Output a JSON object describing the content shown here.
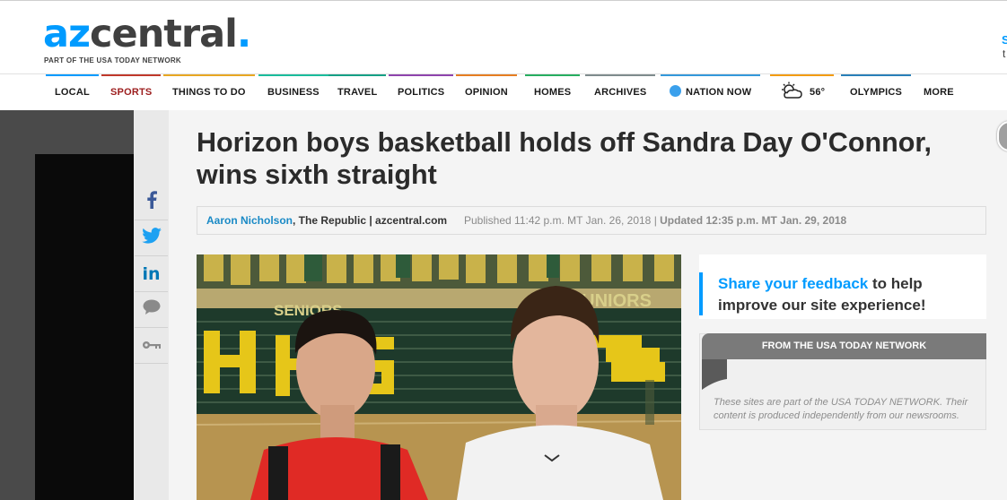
{
  "brand": {
    "logo_az": "az",
    "logo_central": "central",
    "logo_dot": ".",
    "tagline": "PART OF THE USA TODAY NETWORK",
    "edge_text_1": "S",
    "edge_text_2": "t"
  },
  "colors": {
    "brand_blue": "#009bff",
    "active_nav": "#9c1d1d",
    "headline": "#2b2b2b"
  },
  "nav": {
    "items": [
      {
        "label": "LOCAL",
        "color": "#009bff"
      },
      {
        "label": "SPORTS",
        "color": "#c0392b"
      },
      {
        "label": "THINGS TO DO",
        "color": "#e8a723"
      },
      {
        "label": "BUSINESS",
        "color": "#1abc9c"
      },
      {
        "label": "TRAVEL",
        "color": "#16a085"
      },
      {
        "label": "POLITICS",
        "color": "#8e44ad"
      },
      {
        "label": "OPINION",
        "color": "#e67e22"
      },
      {
        "label": "HOMES",
        "color": "#27ae60"
      },
      {
        "label": "ARCHIVES",
        "color": "#7f8c8d"
      },
      {
        "label": "NATION NOW",
        "color": "#3498db"
      },
      {
        "label": "56°",
        "color": "#f39c12"
      },
      {
        "label": "OLYMPICS",
        "color": "#2980b9"
      },
      {
        "label": "MORE",
        "color": "#ffffff"
      }
    ],
    "weather_icon": "partly-cloudy-icon",
    "nation_icon": "circle-dot-icon"
  },
  "share": {
    "icons": [
      "facebook-icon",
      "twitter-icon",
      "linkedin-icon",
      "comment-icon",
      "key-icon"
    ]
  },
  "article": {
    "headline": "Horizon boys basketball holds off Sandra Day O'Connor, wins sixth straight",
    "author": "Aaron Nicholson",
    "org": ", The Republic | azcentral.com",
    "published": "Published 11:42 p.m. MT Jan. 26, 2018 | ",
    "updated": "Updated 12:35 p.m. MT Jan. 29, 2018",
    "photo": {
      "banner_left": "SENIORS",
      "banner_right": "JUNIORS",
      "bleacher_letters": "HHS"
    }
  },
  "sidebar": {
    "feedback_link": "Share your feedback",
    "feedback_rest": " to help improve our site experience!",
    "network_title": "FROM THE USA TODAY NETWORK",
    "network_desc": "These sites are part of the USA TODAY NETWORK. Their content is produced independently from our newsrooms."
  }
}
